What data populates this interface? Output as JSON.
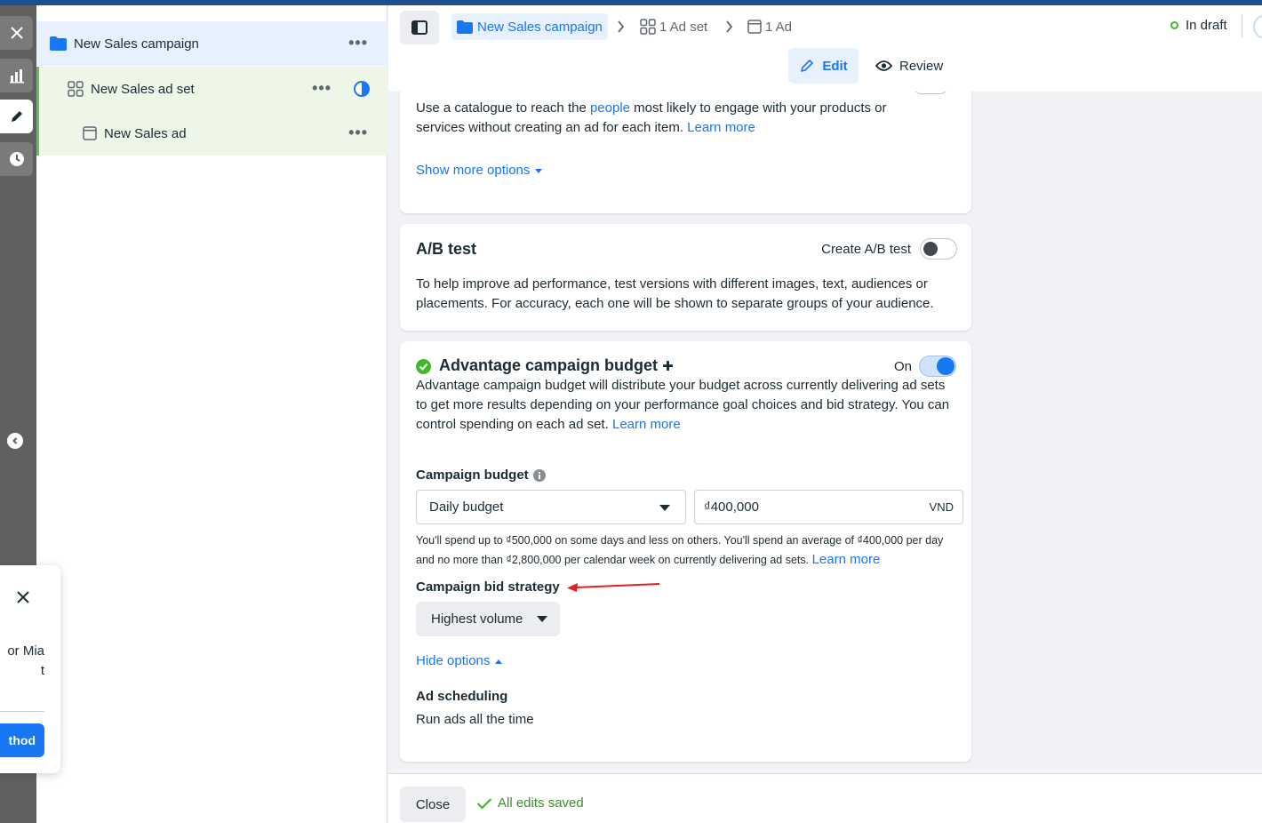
{
  "rail": {
    "items": [
      {
        "icon": "close-icon"
      },
      {
        "icon": "chart-icon"
      },
      {
        "icon": "pencil-icon"
      },
      {
        "icon": "clock-icon"
      }
    ]
  },
  "tree": {
    "campaign": {
      "label": "New Sales campaign"
    },
    "adset": {
      "label": "New Sales ad set"
    },
    "ad": {
      "label": "New Sales ad"
    }
  },
  "popup": {
    "text_line1": "or Mia",
    "text_line2": "t",
    "button_label": "thod"
  },
  "header": {
    "breadcrumb": {
      "campaign": "New Sales campaign",
      "adset": "1 Ad set",
      "ad": "1 Ad"
    },
    "status": "In draft",
    "modes": {
      "edit": "Edit",
      "review": "Review"
    }
  },
  "catalogue": {
    "text": "Use a catalogue to reach the ",
    "people_link": "people",
    "text_after": " most likely to engage with your products or services without creating an ad for each item. ",
    "learn_more": "Learn more",
    "show_more": "Show more options"
  },
  "ab_test": {
    "title": "A/B test",
    "toggle_label": "Create A/B test",
    "description": "To help improve ad performance, test versions with different images, text, audiences or placements. For accuracy, each one will be shown to separate groups of your audience."
  },
  "budget": {
    "title": "Advantage campaign budget",
    "plus": "✚",
    "toggle_label": "On",
    "description": "Advantage campaign budget will distribute your budget across currently delivering ad sets to get more results depending on your performance goal choices and bid strategy. You can control spending on each ad set. ",
    "learn_more": "Learn more",
    "campaign_budget_label": "Campaign budget",
    "budget_type": "Daily budget",
    "amount": "₫400,000",
    "currency": "VND",
    "spend_note": "You'll spend up to ₫500,000 on some days and less on others. You'll spend an average of ₫400,000 per day and no more than ₫2,800,000 per calendar week on currently delivering ad sets. ",
    "spend_learn_more": "Learn more",
    "bid_strategy_label": "Campaign bid strategy",
    "bid_strategy_value": "Highest volume",
    "hide_options": "Hide options",
    "scheduling_label": "Ad scheduling",
    "scheduling_value": "Run ads all the time"
  },
  "footer": {
    "close": "Close",
    "saved": "All edits saved"
  },
  "colors": {
    "accent": "#1877f2",
    "success": "#42b72a",
    "annotation_arrow": "#e02020"
  }
}
